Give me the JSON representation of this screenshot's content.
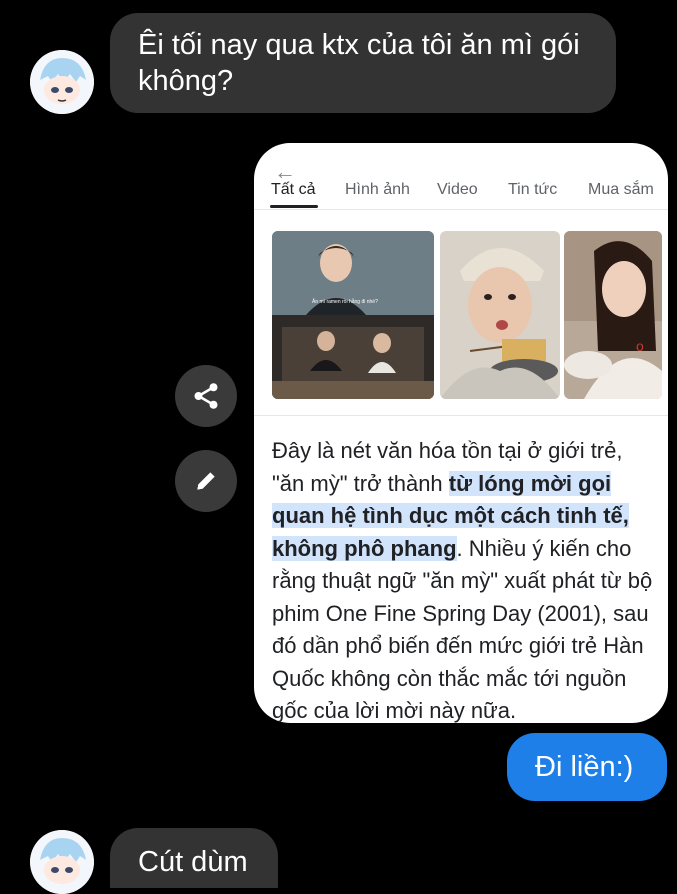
{
  "messages": {
    "first_incoming": "Êi tối nay qua ktx của tôi ăn mì gói không?",
    "outgoing": "Đi liền:)",
    "second_incoming": "Cút dùm"
  },
  "screenshot": {
    "tabs": [
      "Tất cả",
      "Hình ảnh",
      "Video",
      "Tin tức",
      "Mua sắm"
    ],
    "image_caption": "Ăn mì ramen rồi hẵng đi nhé?",
    "snippet_before": "Đây là nét văn hóa tồn tại ở giới trẻ, \"ăn mỳ\" trở thành ",
    "snippet_highlight": "từ lóng mời gọi quan hệ tình dục một cách tinh tế, không phô phang",
    "snippet_after": ". Nhiều ý kiến cho rằng thuật ngữ \"ăn mỳ\" xuất phát từ bộ phim One Fine Spring Day (2001), sau đó dần phổ biến đến mức giới trẻ Hàn Quốc không còn thắc mắc tới nguồn gốc của lời mời này nữa."
  },
  "icons": {
    "share": "share-icon",
    "edit": "pencil-icon",
    "back": "back-arrow-icon"
  },
  "colors": {
    "background": "#000000",
    "incoming_bubble": "#333334",
    "outgoing_bubble": "#1f7fe8",
    "highlight": "#d2e3fc"
  }
}
